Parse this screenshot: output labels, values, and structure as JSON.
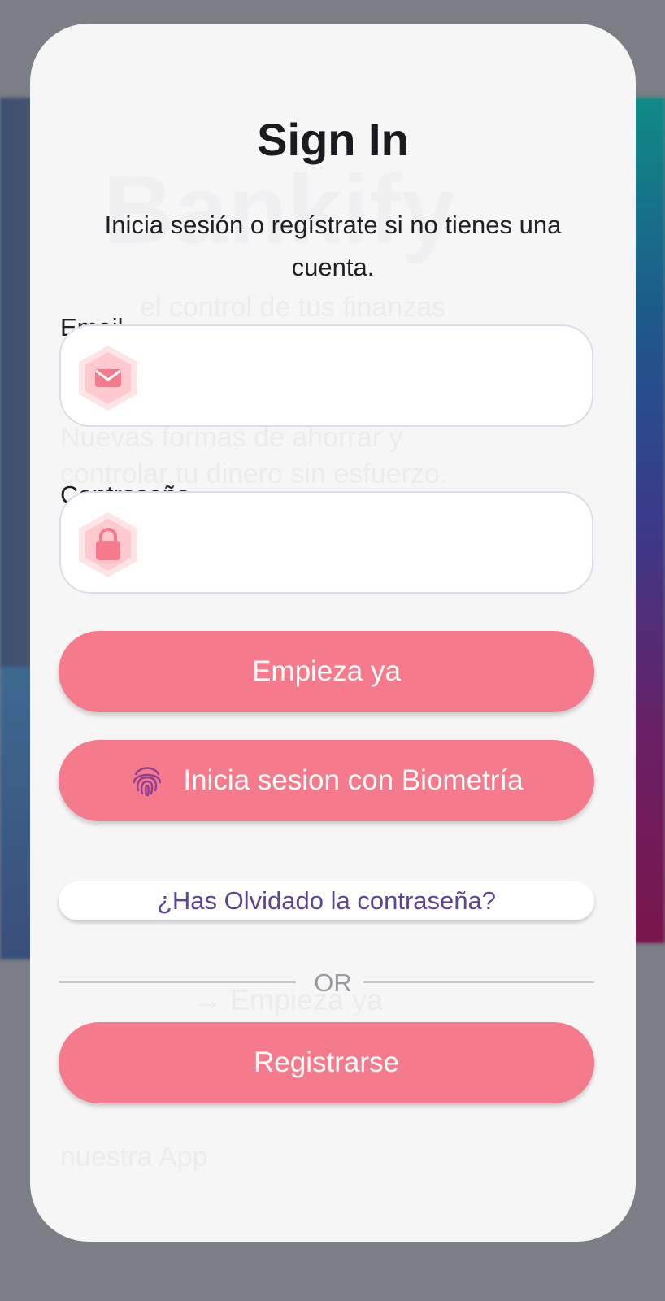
{
  "background": {
    "brand": "Bankify",
    "tagline": "el control de tus finanzas",
    "desc_line1": "Nuevas formas de ahorrar y",
    "desc_line2": "controlar tu dinero sin esfuerzo.",
    "cta": "Empieza ya",
    "footer": "nuestra App"
  },
  "signin": {
    "title": "Sign In",
    "subtitle": "Inicia sesión o regístrate si no tienes una cuenta.",
    "email_label": "Email",
    "email_value": "",
    "email_icon": "mail-icon",
    "password_label": "Contraseña",
    "password_value": "",
    "password_icon": "lock-icon",
    "start_button": "Empieza ya",
    "biometric_button": "Inicia sesion con Biometría",
    "biometric_icon": "fingerprint-icon",
    "forgot_link": "¿Has Olvidado la contraseña?",
    "or_label": "OR",
    "register_button": "Registrarse"
  },
  "colors": {
    "accent": "#f57b8c",
    "icon_bg": "#ffe4e6",
    "icon_fg": "#f57b8c",
    "link": "#5e4591",
    "fingerprint": "#8e3f8f"
  }
}
